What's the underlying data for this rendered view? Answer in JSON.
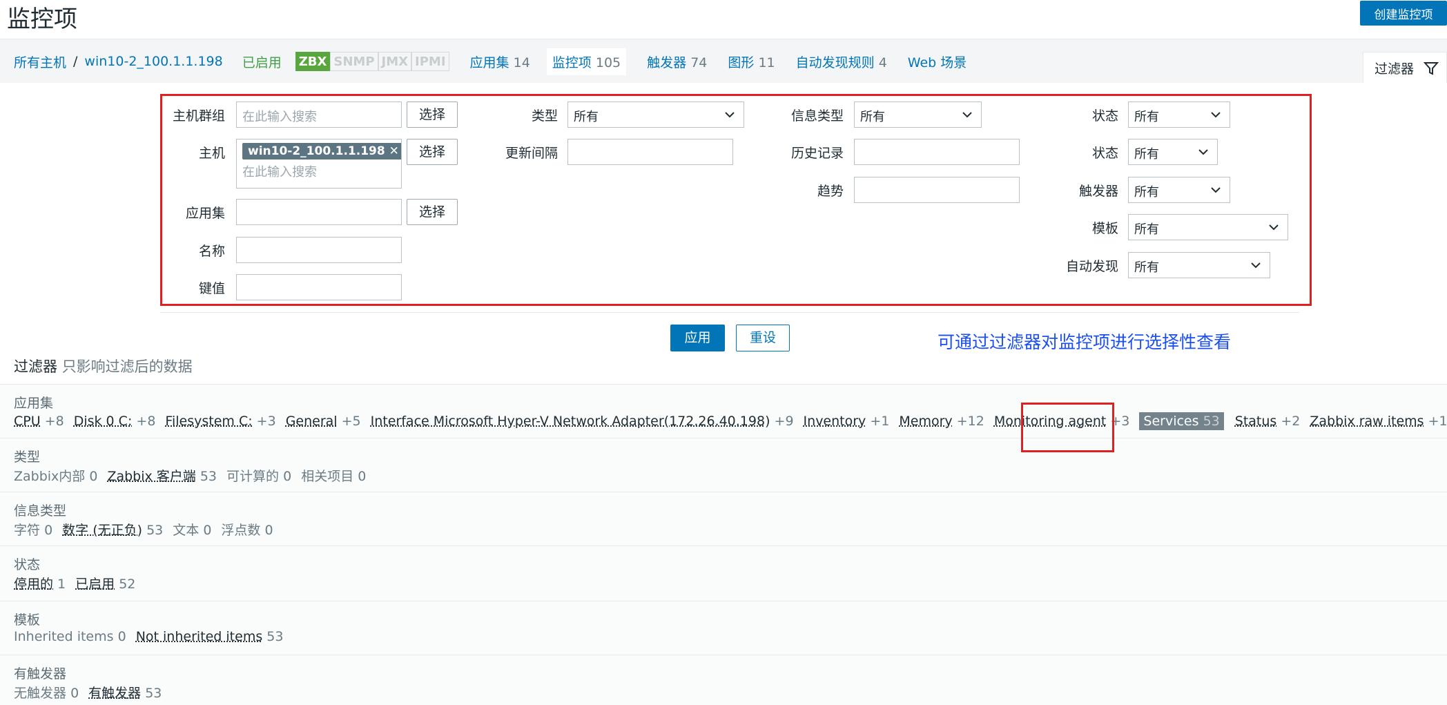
{
  "header": {
    "title": "监控项",
    "create_button": "创建监控项"
  },
  "nav": {
    "all_hosts": "所有主机",
    "separator": "/",
    "host": "win10-2_100.1.1.198",
    "enabled": "已启用",
    "protocols": [
      "ZBX",
      "SNMP",
      "JMX",
      "IPMI"
    ],
    "links": [
      {
        "label": "应用集",
        "count": "14"
      },
      {
        "label": "监控项",
        "count": "105"
      },
      {
        "label": "触发器",
        "count": "74"
      },
      {
        "label": "图形",
        "count": "11"
      },
      {
        "label": "自动发现规则",
        "count": "4"
      },
      {
        "label": "Web 场景",
        "count": ""
      }
    ],
    "filter_tab": "过滤器"
  },
  "form": {
    "host_group_label": "主机群组",
    "search_placeholder": "在此输入搜索",
    "select_label": "选择",
    "host_label": "主机",
    "host_tag": "win10-2_100.1.1.198",
    "app_label": "应用集",
    "name_label": "名称",
    "key_label": "键值",
    "type_label": "类型",
    "type_value": "所有",
    "interval_label": "更新间隔",
    "info_type_label": "信息类型",
    "info_type_value": "所有",
    "history_label": "历史记录",
    "trends_label": "趋势",
    "state_label": "状态",
    "state_value": "所有",
    "status_label": "状态",
    "status_value": "所有",
    "triggers_label": "触发器",
    "triggers_value": "所有",
    "template_label": "模板",
    "template_value": "所有",
    "discovery_label": "自动发现",
    "discovery_value": "所有",
    "apply": "应用",
    "reset": "重设"
  },
  "annotation": "可通过过滤器对监控项进行选择性查看",
  "filter_note": {
    "bold": "过滤器",
    "rest": "只影响过滤后的数据"
  },
  "sections": [
    {
      "title": "应用集",
      "items": [
        {
          "name": "CPU",
          "count": "+8"
        },
        {
          "name": "Disk 0 C:",
          "count": "+8"
        },
        {
          "name": "Filesystem C:",
          "count": "+3"
        },
        {
          "name": "General",
          "count": "+5"
        },
        {
          "name": "Interface Microsoft Hyper-V Network Adapter(172.26.40.198)",
          "count": "+9"
        },
        {
          "name": "Inventory",
          "count": "+1"
        },
        {
          "name": "Memory",
          "count": "+12"
        },
        {
          "name": "Monitoring agent",
          "count": "+3"
        },
        {
          "name": "Services",
          "count": "53"
        },
        {
          "name": "Status",
          "count": "+2"
        },
        {
          "name": "Zabbix raw items",
          "count": "+1"
        }
      ]
    },
    {
      "title": "类型",
      "items": [
        {
          "name": "Zabbix内部",
          "count": "0"
        },
        {
          "name": "Zabbix 客户端",
          "count": "53"
        },
        {
          "name": "可计算的",
          "count": "0"
        },
        {
          "name": "相关项目",
          "count": "0"
        }
      ]
    },
    {
      "title": "信息类型",
      "items": [
        {
          "name": "字符",
          "count": "0"
        },
        {
          "name": "数字 (无正负)",
          "count": "53"
        },
        {
          "name": "文本",
          "count": "0"
        },
        {
          "name": "浮点数",
          "count": "0"
        }
      ]
    },
    {
      "title": "状态",
      "items": [
        {
          "name": "停用的",
          "count": "1"
        },
        {
          "name": "已启用",
          "count": "52"
        }
      ]
    },
    {
      "title": "模板",
      "items": [
        {
          "name": "Inherited items",
          "count": "0"
        },
        {
          "name": "Not inherited items",
          "count": "53"
        }
      ]
    },
    {
      "title": "有触发器",
      "items": [
        {
          "name": "无触发器",
          "count": "0"
        },
        {
          "name": "有触发器",
          "count": "53"
        }
      ]
    }
  ],
  "colors": {
    "accent": "#0275b8",
    "zbx": "#59a63f",
    "highlight": "#e02020",
    "annotation": "#1a4ff0"
  }
}
